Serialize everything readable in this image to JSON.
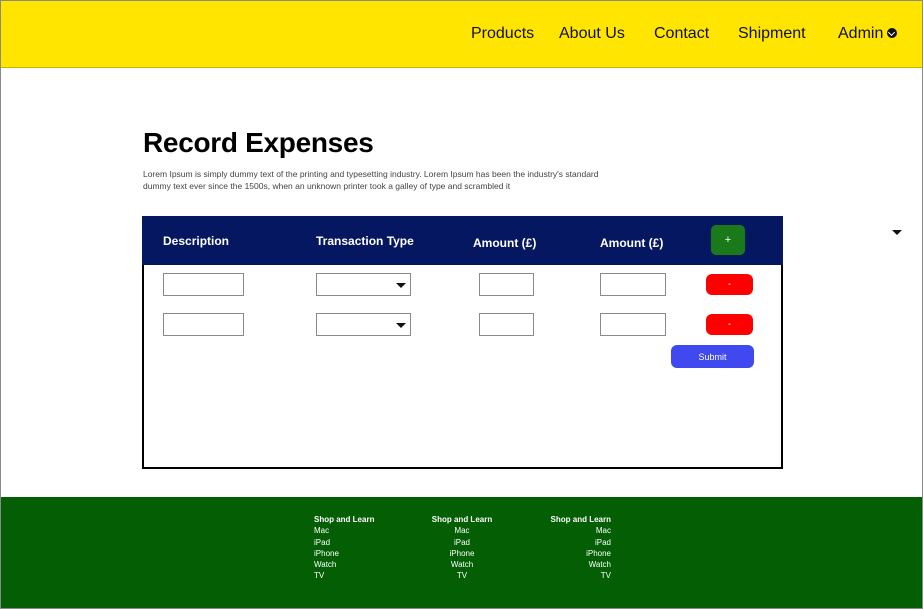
{
  "nav": {
    "items": [
      {
        "label": "Products"
      },
      {
        "label": "About Us"
      },
      {
        "label": "Contact"
      },
      {
        "label": "Shipment"
      },
      {
        "label": "Admin"
      }
    ]
  },
  "page": {
    "title": "Record Expenses",
    "description": "Lorem Ipsum is simply dummy text of the printing and typesetting industry. Lorem Ipsum has been the industry's standard dummy text ever since the 1500s, when an unknown printer took a galley of type and scrambled it"
  },
  "table": {
    "headers": [
      "Description",
      "Transaction Type",
      "Amount (£)",
      "Amount (£)"
    ],
    "add_label": "+",
    "remove_label": "-",
    "submit_label": "Submit",
    "rows": [
      {
        "description": "",
        "transaction_type": "",
        "amount_1": "",
        "amount_2": ""
      },
      {
        "description": "",
        "transaction_type": "",
        "amount_1": "",
        "amount_2": ""
      }
    ]
  },
  "footer": {
    "columns": [
      {
        "title": "Shop and Learn",
        "links": [
          "Mac",
          "iPad",
          "iPhone",
          "Watch",
          "TV"
        ]
      },
      {
        "title": "Shop and Learn",
        "links": [
          "Mac",
          "iPad",
          "iPhone",
          "Watch",
          "TV"
        ]
      },
      {
        "title": "Shop and Learn",
        "links": [
          "Mac",
          "iPad",
          "iPhone",
          "Watch",
          "TV"
        ]
      }
    ]
  },
  "colors": {
    "header_bg": "#ffe500",
    "table_head_bg": "#051760",
    "add_button": "#1a7a1a",
    "remove_button": "#ff0000",
    "submit_button": "#4048f0",
    "footer_bg": "#045e04"
  },
  "icons": {
    "admin_menu": "chevron-down-circle-icon",
    "select_caret": "caret-down-icon"
  }
}
